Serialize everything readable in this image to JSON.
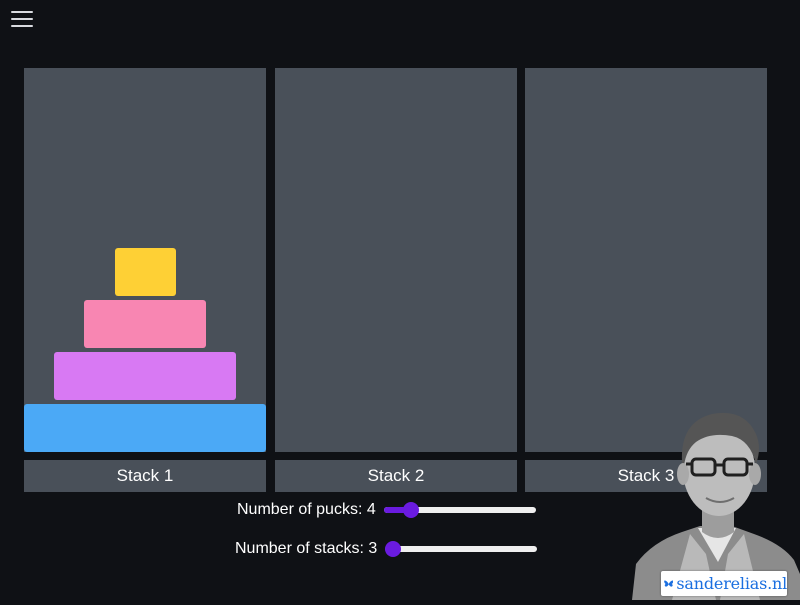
{
  "header": {
    "menu_icon": "hamburger-menu-icon"
  },
  "stacks": [
    {
      "label": "Stack 1"
    },
    {
      "label": "Stack 2"
    },
    {
      "label": "Stack 3"
    }
  ],
  "pucks": [
    {
      "stack": 1,
      "size": 1,
      "color": "#fed035"
    },
    {
      "stack": 1,
      "size": 2,
      "color": "#f886b2"
    },
    {
      "stack": 1,
      "size": 3,
      "color": "#d879f3"
    },
    {
      "stack": 1,
      "size": 4,
      "color": "#4ba9f6"
    }
  ],
  "controls": {
    "pucks": {
      "label": "Number of pucks: 4",
      "value": 4,
      "min": 3,
      "max": 10
    },
    "stacks": {
      "label": "Number of stacks: 3",
      "value": 3,
      "min": 3,
      "max": 10
    }
  },
  "colors": {
    "background": "#0f1115",
    "stack": "#495059",
    "accent": "#6a1be0"
  },
  "branding": {
    "avatar_icon": "person-portrait-icon",
    "butterfly_icon": "butterfly-icon",
    "site": "sanderelias.nl"
  }
}
